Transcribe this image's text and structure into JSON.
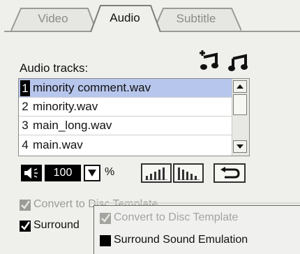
{
  "tabs": [
    {
      "label": "Video",
      "active": false
    },
    {
      "label": "Audio",
      "active": true
    },
    {
      "label": "Subtitle",
      "active": false
    }
  ],
  "audio_tracks_label": "Audio tracks:",
  "tracks": [
    {
      "number": "1",
      "name": "minority comment.wav",
      "selected": true
    },
    {
      "number": "2",
      "name": "minority.wav",
      "selected": false
    },
    {
      "number": "3",
      "name": "main_long.wav",
      "selected": false
    },
    {
      "number": "4",
      "name": "main.wav",
      "selected": false
    }
  ],
  "volume": {
    "value": "100",
    "unit": "%"
  },
  "checkboxes": {
    "convert_label": "Convert to Disc Template",
    "convert_checked": true,
    "convert_disabled": true,
    "surround_label_partial": "Surround",
    "surround_checked": true
  },
  "popup": {
    "convert_label": "Convert to Disc Template",
    "surround_label": "Surround Sound Emulation"
  },
  "icons": {
    "add_track": "music-add-icon",
    "remove_track": "music-note-icon",
    "speaker": "speaker-icon",
    "dropdown": "triangle-down-icon",
    "eq1": "equalizer-ascending-icon",
    "eq2": "equalizer-descending-icon",
    "undo": "undo-arrow-icon"
  },
  "colors": {
    "selection": "#b7c6ec",
    "panel_bg": "#efefec"
  }
}
